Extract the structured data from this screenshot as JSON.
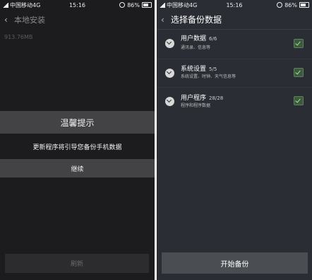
{
  "left": {
    "status": {
      "carrier": "中国移动4G",
      "time": "15:16",
      "battery": "86%"
    },
    "title": "本地安装",
    "size_text": "913.76MB",
    "dialog": {
      "title": "温馨提示",
      "message": "更新程序将引导您备份手机数据",
      "button": "继续"
    },
    "refresh_button": "刷新"
  },
  "right": {
    "status": {
      "carrier": "中国移动4G",
      "time": "15:16",
      "battery": "86%"
    },
    "title": "选择备份数据",
    "items": [
      {
        "name": "用户数据",
        "count": "6/6",
        "desc": "通讯录、信息等",
        "checked": true
      },
      {
        "name": "系统设置",
        "count": "5/5",
        "desc": "系统设置、时钟、天气信息等",
        "checked": true
      },
      {
        "name": "用户程序",
        "count": "28/28",
        "desc": "程序和程序数据",
        "checked": true
      }
    ],
    "start_button": "开始备份"
  }
}
